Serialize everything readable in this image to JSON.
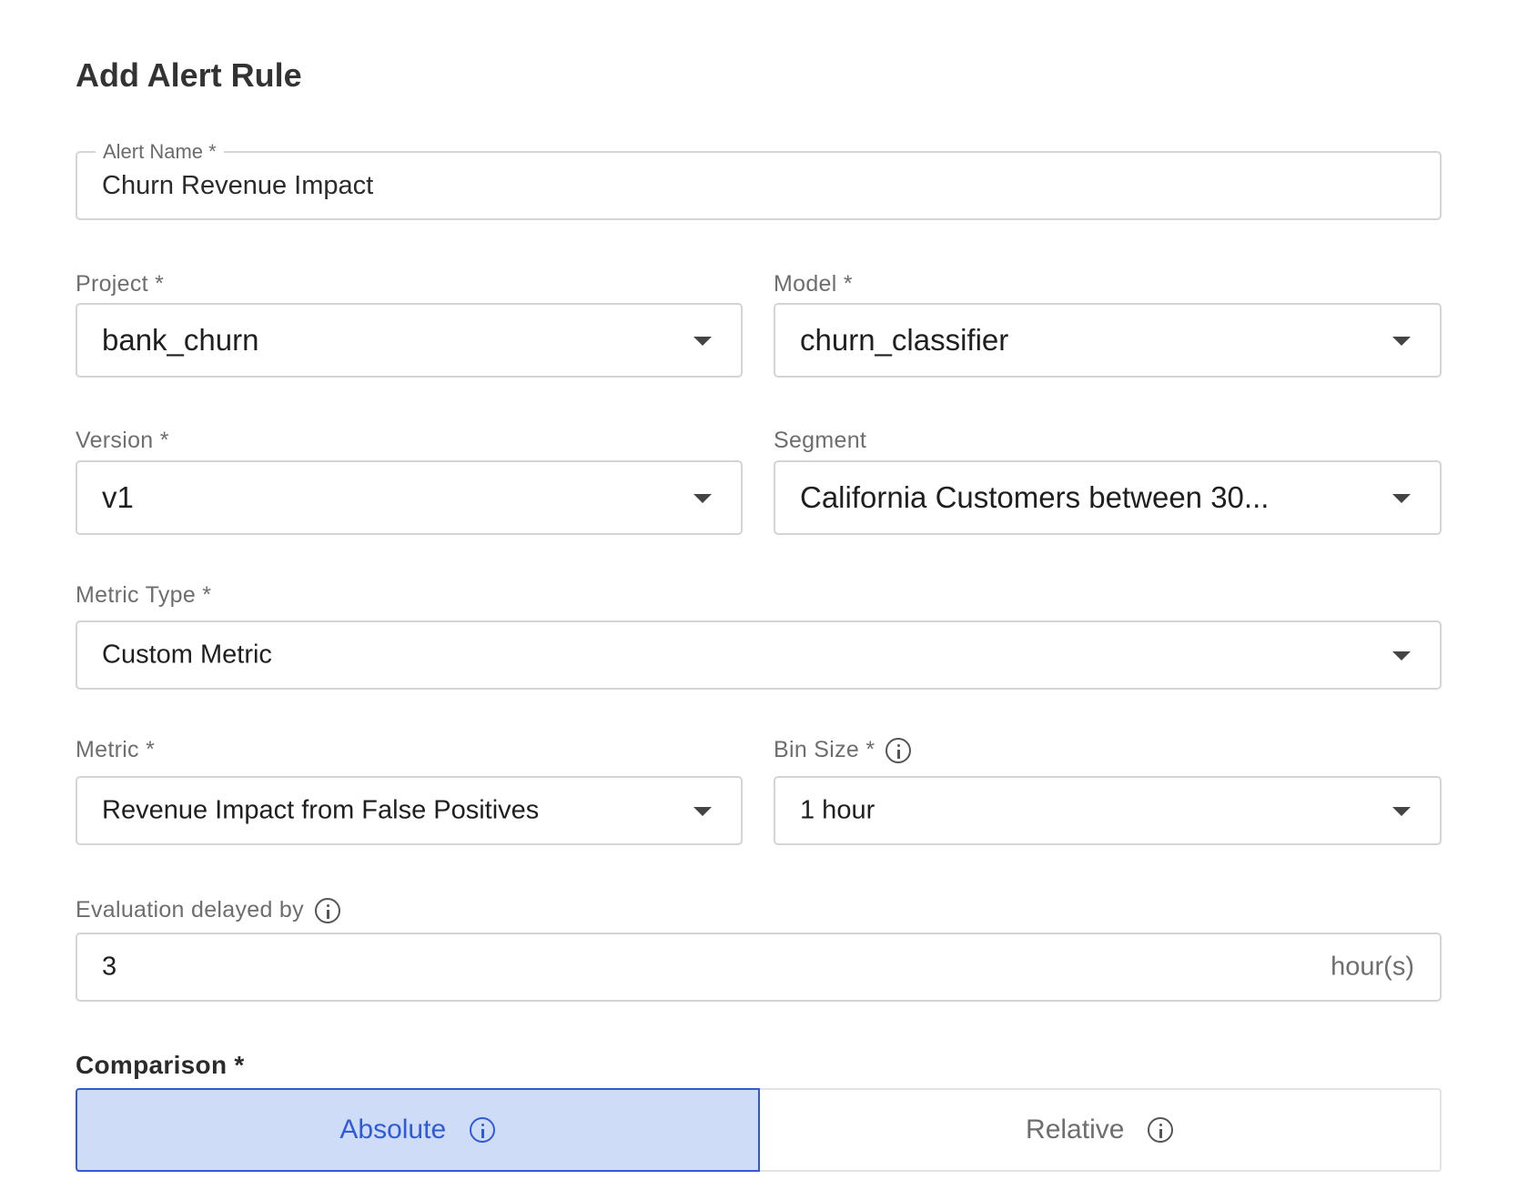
{
  "title": "Add Alert Rule",
  "alert_name": {
    "label": "Alert Name *",
    "value": "Churn Revenue Impact"
  },
  "project": {
    "label": "Project *",
    "value": "bank_churn"
  },
  "model": {
    "label": "Model *",
    "value": "churn_classifier"
  },
  "version": {
    "label": "Version *",
    "value": "v1"
  },
  "segment": {
    "label": "Segment",
    "value": "California Customers between 30..."
  },
  "metric_type": {
    "label": "Metric Type *",
    "value": "Custom Metric"
  },
  "metric": {
    "label": "Metric *",
    "value": "Revenue Impact from False Positives"
  },
  "bin_size": {
    "label": "Bin Size *",
    "value": "1 hour",
    "icon": "info-icon"
  },
  "evaluation_delay": {
    "label": "Evaluation delayed by",
    "value": "3",
    "suffix": "hour(s)",
    "icon": "info-icon"
  },
  "comparison": {
    "label": "Comparison *",
    "options": [
      {
        "label": "Absolute",
        "selected": true,
        "icon": "info-icon"
      },
      {
        "label": "Relative",
        "selected": false,
        "icon": "info-icon"
      }
    ]
  },
  "colors": {
    "accent": "#2f5bd6",
    "accent_bg": "#cfdcf8",
    "border": "#d4d4d4"
  }
}
